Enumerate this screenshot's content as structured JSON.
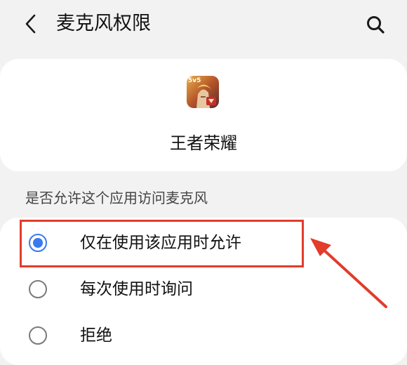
{
  "header": {
    "title": "麦克风权限",
    "back_icon": "chevron-left-icon",
    "search_icon": "search-icon"
  },
  "app": {
    "name": "王者荣耀",
    "icon": "app-icon",
    "icon_badge": "5v5"
  },
  "permission": {
    "question": "是否允许这个应用访问麦克风",
    "options": [
      {
        "label": "仅在使用该应用时允许",
        "selected": true
      },
      {
        "label": "每次使用时询问",
        "selected": false
      },
      {
        "label": "拒绝",
        "selected": false
      }
    ]
  },
  "annotation": {
    "highlight_color": "#e23c2c",
    "arrow_color": "#e23c2c"
  },
  "colors": {
    "accent": "#3a79ee",
    "background": "#f2f2f2",
    "card": "#ffffff"
  }
}
